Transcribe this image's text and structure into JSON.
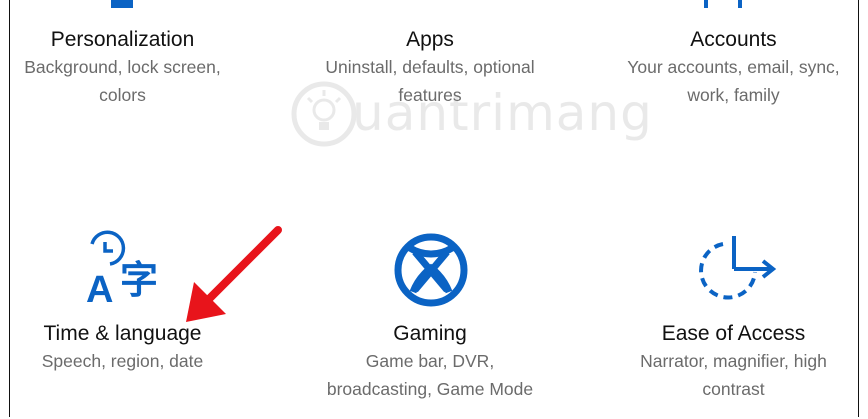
{
  "settings": {
    "tiles": [
      {
        "title": "Personalization",
        "desc": "Background, lock screen, colors",
        "desc_lines": [
          "Background, lock screen,",
          "colors"
        ]
      },
      {
        "title": "Apps",
        "desc": "Uninstall, defaults, optional features",
        "desc_lines": [
          "Uninstall, defaults, optional",
          "features"
        ]
      },
      {
        "title": "Accounts",
        "desc": "Your accounts, email, sync, work, family",
        "desc_lines": [
          "Your accounts, email, sync,",
          "work, family"
        ]
      },
      {
        "title": "Time & language",
        "desc": "Speech, region, date",
        "desc_lines": [
          "Speech, region, date"
        ],
        "icon": "time-language-icon"
      },
      {
        "title": "Gaming",
        "desc": "Game bar, DVR, broadcasting, Game Mode",
        "desc_lines": [
          "Game bar, DVR,",
          "broadcasting, Game Mode"
        ],
        "icon": "xbox-icon"
      },
      {
        "title": "Ease of Access",
        "desc": "Narrator, magnifier, high contrast",
        "desc_lines": [
          "Narrator, magnifier, high",
          "contrast"
        ],
        "icon": "ease-of-access-icon"
      }
    ]
  },
  "watermark": {
    "text": "uantrimang"
  },
  "colors": {
    "accent": "#0b63c4",
    "annotation_arrow": "#e8141b",
    "title": "#111111",
    "description": "#6b6b6b"
  }
}
